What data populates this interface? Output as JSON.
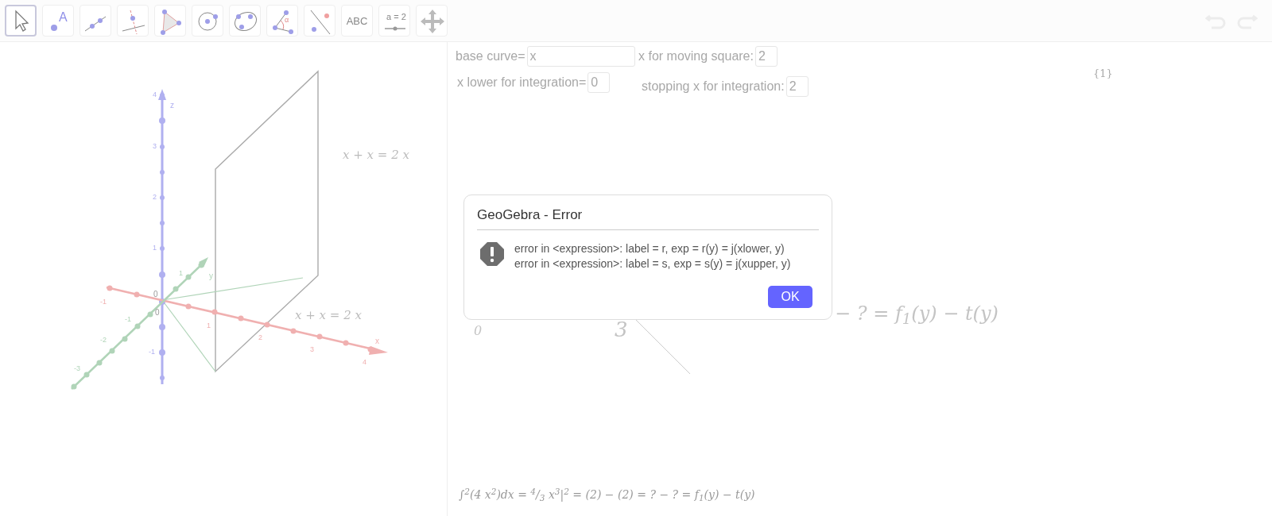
{
  "toolbar": {
    "tools": [
      {
        "kind": "move",
        "selected": true
      },
      {
        "kind": "point",
        "label": "A",
        "selected": false
      },
      {
        "kind": "line",
        "selected": false
      },
      {
        "kind": "perpendicular",
        "selected": false
      },
      {
        "kind": "polygon",
        "selected": false
      },
      {
        "kind": "circle",
        "selected": false
      },
      {
        "kind": "conic",
        "selected": false
      },
      {
        "kind": "angle",
        "label": "α",
        "selected": false
      },
      {
        "kind": "reflect",
        "selected": false
      },
      {
        "kind": "text",
        "label": "ABC",
        "selected": false
      },
      {
        "kind": "slider",
        "label": "a = 2",
        "selected": false
      },
      {
        "kind": "move_view",
        "selected": false
      }
    ],
    "undo": {
      "disabled": true
    },
    "redo": {
      "disabled": true
    }
  },
  "graphics_3d": {
    "x_axis": {
      "name": "x",
      "ticks": [
        "-1",
        "1",
        "2",
        "3",
        "4"
      ]
    },
    "y_axis": {
      "name": "y",
      "ticks": [
        "1",
        "-1",
        "-2",
        "-3"
      ]
    },
    "z_axis": {
      "name": "z",
      "ticks": [
        "4",
        "3",
        "2",
        "1",
        "-1"
      ]
    },
    "origin_labels": [
      "0",
      "0"
    ],
    "equation_labels": [
      "x + x = 2 x",
      "x + x = 2 x"
    ]
  },
  "algebra_inputs": [
    {
      "label": "base curve=",
      "value": "x"
    },
    {
      "label": "x for moving square:",
      "value": "2"
    },
    {
      "label": "x lower for integration=",
      "value": "0"
    },
    {
      "label": "stopping x for integration:",
      "value": "2"
    }
  ],
  "list_label": "{1}",
  "formula_fragments": [
    {
      "kind": "tail",
      "text": "− ? = f$_{1}$(y) − t(y)"
    },
    {
      "kind": "lower_limit",
      "text": "0"
    },
    {
      "kind": "denominator",
      "text": "3"
    }
  ],
  "bottom_formula": "∫$^{2}$(4 x$^{2}$)dx = $^{4}$/$_{3}$ x$^{3}$|$^{2}$ = (2) − (2) = ? − ? = f$_{1}$(y) − t(y)",
  "dialog": {
    "title": "GeoGebra - Error",
    "messages": [
      "error in <expression>: label = r, exp = r(y) = j(xlower, y)",
      "error in <expression>: label = s, exp = s(y) = j(xupper, y)"
    ],
    "button": "OK"
  }
}
